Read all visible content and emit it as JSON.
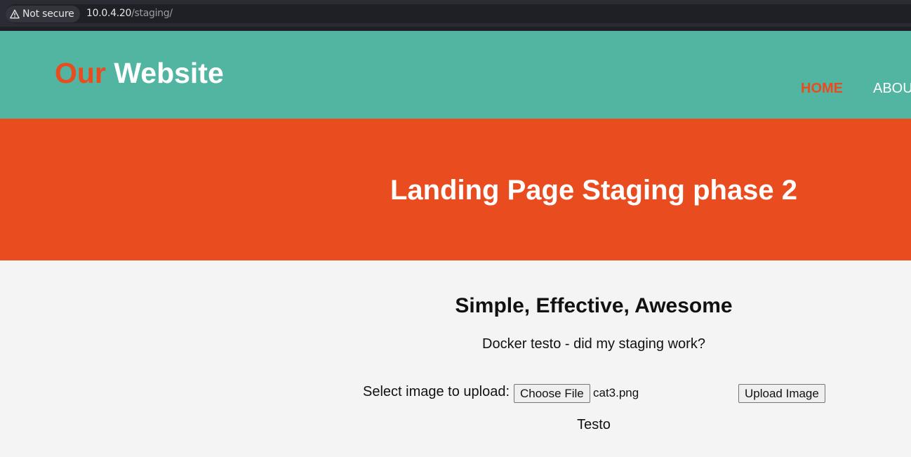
{
  "browser": {
    "security_label": "Not secure",
    "url_host": "10.0.4.20",
    "url_path": "/staging/"
  },
  "header": {
    "logo_accent": "Our",
    "logo_main": "Website",
    "nav": [
      {
        "label": "HOME",
        "active": true
      },
      {
        "label": "ABOUT",
        "active": false
      }
    ]
  },
  "hero": {
    "title": "Landing Page Staging phase 2"
  },
  "content": {
    "title": "Simple, Effective, Awesome",
    "text": "Docker testo - did my staging work?",
    "upload": {
      "label": "Select image to upload:",
      "choose_button": "Choose File",
      "file_name": "cat3.png",
      "submit_button": "Upload Image"
    },
    "result": "Testo"
  },
  "colors": {
    "header_bg": "#52b5a2",
    "accent": "#e84c1f",
    "content_bg": "#f4f4f4"
  },
  "icons": {
    "security": "warning-triangle-icon"
  }
}
